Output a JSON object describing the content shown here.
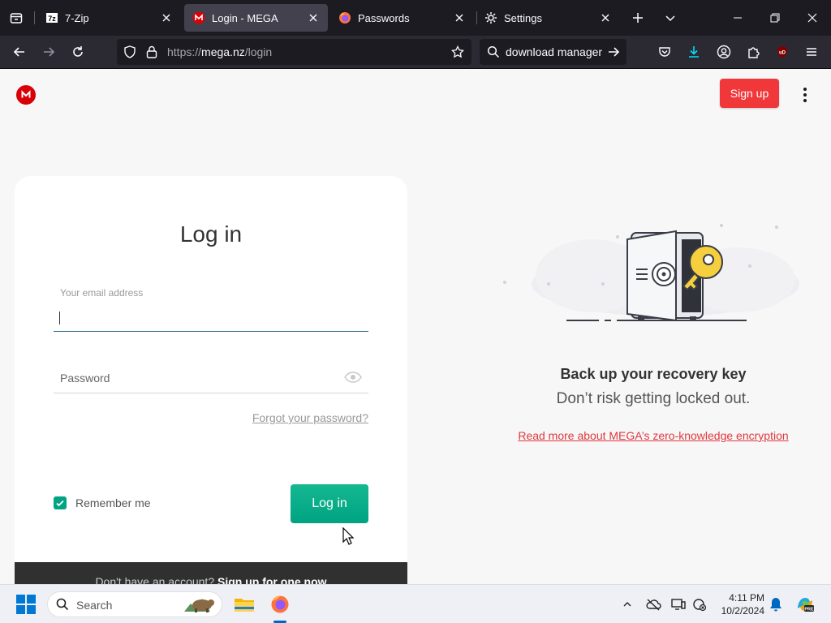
{
  "browser": {
    "tabs": [
      {
        "label": "7-Zip",
        "favicon": "seven-zip-icon",
        "active": false
      },
      {
        "label": "Login - MEGA",
        "favicon": "mega-icon",
        "active": true
      },
      {
        "label": "Passwords",
        "favicon": "firefox-icon",
        "active": false
      },
      {
        "label": "Settings",
        "favicon": "gear-icon",
        "active": false
      }
    ],
    "url_prefix": "https://",
    "url_host": "mega.nz",
    "url_path": "/login",
    "search_text": "download manager"
  },
  "page": {
    "signup_label": "Sign up",
    "login_title": "Log in",
    "email_label": "Your email address",
    "email_value": "",
    "password_placeholder": "Password",
    "forgot_link": "Forgot your password?",
    "remember_label": "Remember me",
    "remember_checked": true,
    "login_button": "Log in",
    "footer_prefix": "Don't have an account?",
    "footer_link": "Sign up for one now",
    "recovery_title": "Back up your recovery key",
    "recovery_subtitle": "Don’t risk getting locked out.",
    "recovery_link": "Read more about MEGA’s zero-knowledge encryption",
    "accent_color": "#00a382",
    "brand_color": "#d90007"
  },
  "taskbar": {
    "search_label": "Search",
    "time": "4:11 PM",
    "date": "10/2/2024"
  }
}
